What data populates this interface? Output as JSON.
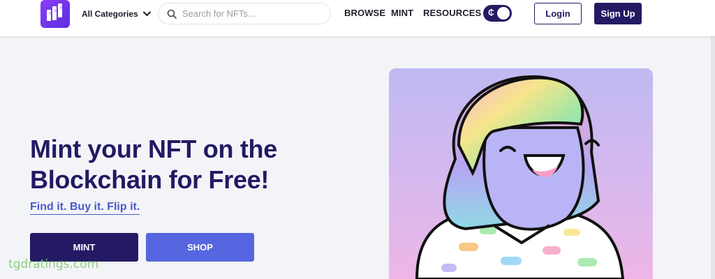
{
  "header": {
    "categories_label": "All Categories",
    "search_placeholder": "Search for NFTs...",
    "nav": [
      "BROWSE",
      "MINT",
      "RESOURCES"
    ],
    "currency_symbol": "₵",
    "login_label": "Login",
    "signup_label": "Sign Up"
  },
  "hero": {
    "title": "Mint your NFT on the Blockchain for Free!",
    "tagline": "Find it. Buy it. Flip it.",
    "mint_label": "MINT",
    "shop_label": "SHOP"
  },
  "watermark": "tgdratings.com",
  "colors": {
    "brand": "#231a63",
    "accent": "#5566e0",
    "logo": "#7b35f0"
  },
  "icons": [
    "logo-icon",
    "chevron-down-icon",
    "search-icon",
    "currency-icon"
  ]
}
